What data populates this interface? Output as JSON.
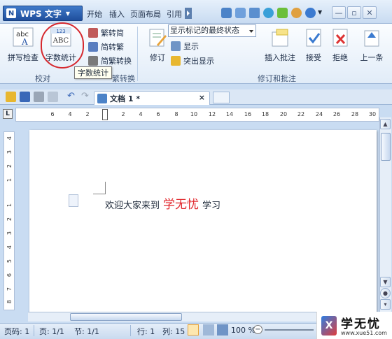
{
  "app": {
    "menu_button": "WPS 文字",
    "logo_letter": "N"
  },
  "menu_tabs": [
    "开始",
    "插入",
    "页面布局",
    "引用"
  ],
  "ribbon": {
    "spell_check": "拼写检查",
    "word_count": "字数统计",
    "word_count_icon_num": "123",
    "word_count_icon_abc": "ABC",
    "spell_icon_text": "abc",
    "to_traditional": "繁转简",
    "to_simplified": "简转繁",
    "convert": "简繁转换",
    "group_proofing": "校对",
    "group_convert_partial": "繁转换",
    "revise": "修订",
    "display_mode": "显示标记的最终状态",
    "show": "显示",
    "highlight": "突出显示",
    "insert_comment": "插入批注",
    "accept": "接受",
    "reject": "拒绝",
    "prev_item": "上一条",
    "group_review": "修订和批注"
  },
  "tooltip": "字数统计",
  "doc_tab": {
    "title": "文档 1 *",
    "close": "×"
  },
  "hruler_ticks": [
    "6",
    "4",
    "2",
    "2",
    "4",
    "6",
    "8",
    "10",
    "12",
    "14",
    "16",
    "18",
    "20",
    "22",
    "24",
    "26",
    "28",
    "30"
  ],
  "vruler_ticks": [
    "4",
    "3",
    "2",
    "1",
    "1",
    "2",
    "3",
    "4",
    "5",
    "6",
    "7",
    "8"
  ],
  "ruler_corner": "L",
  "document": {
    "text_before": "欢迎大家来到",
    "brand": "学无忧",
    "text_after": "学习"
  },
  "status": {
    "page_code": "页码: 1",
    "page": "页: 1/1",
    "section": "节: 1/1",
    "row": "行: 1",
    "column": "列: 15",
    "zoom": "100 %"
  },
  "watermark": {
    "title": "学无忧",
    "url": "www.xue51.com"
  },
  "colors": {
    "accent": "#1f4f9c",
    "highlight_circle": "#d6282e",
    "brand_text": "#e0262b"
  }
}
